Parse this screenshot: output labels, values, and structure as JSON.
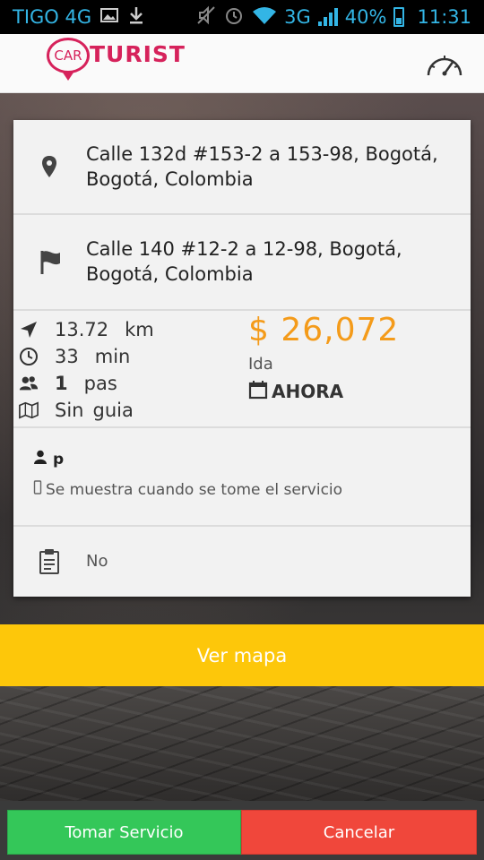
{
  "status_bar": {
    "carrier": "TIGO 4G",
    "network": "3G",
    "battery": "40%",
    "time": "11:31",
    "icons": [
      "image-icon",
      "download-icon",
      "mute-icon",
      "alarm-icon",
      "wifi-icon",
      "signal-icon",
      "battery-icon"
    ]
  },
  "header": {
    "logo_car": "CAR",
    "logo_word": "TURIST",
    "brand_color": "#d6225b",
    "speedometer_icon": "speedometer-icon"
  },
  "trip": {
    "origin": "Calle 132d #153-2 a 153-98, Bogotá, Bogotá, Colombia",
    "destination": "Calle 140 #12-2 a 12-98, Bogotá, Bogotá, Colombia",
    "distance_value": "13.72",
    "distance_unit": "km",
    "duration_value": "33",
    "duration_unit": "min",
    "passengers_value": "1",
    "passengers_unit": "pas",
    "guide_value": "Sin",
    "guide_unit": "guia",
    "price": "$ 26,072",
    "trip_type": "Ida",
    "when": "AHORA",
    "price_color": "#f49b1a"
  },
  "driver": {
    "name": "p",
    "phone_note": "Se muestra cuando se tome el servicio"
  },
  "notes": {
    "value": "No"
  },
  "actions": {
    "map_label": "Ver mapa",
    "accept_label": "Tomar Servicio",
    "cancel_label": "Cancelar",
    "map_color": "#fdc70a",
    "accept_color": "#34c759",
    "cancel_color": "#f0473b"
  }
}
